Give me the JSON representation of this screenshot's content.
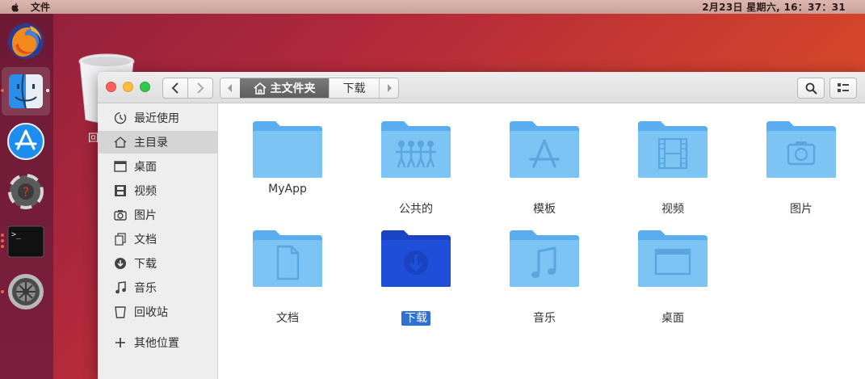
{
  "menubar": {
    "app_menu": "文件",
    "clock": "2月23日 星期六, 16：37：31"
  },
  "dock": {
    "items": [
      "firefox-icon",
      "finder-icon",
      "app-store-icon",
      "help-icon",
      "terminal-icon",
      "settings-icon"
    ]
  },
  "desktop": {
    "trash_label": "回"
  },
  "window": {
    "breadcrumb": {
      "home": "主文件夹",
      "current": "下载"
    }
  },
  "sidebar": {
    "items": [
      {
        "label": "最近使用",
        "icon": "recent-icon"
      },
      {
        "label": "主目录",
        "icon": "home-icon"
      },
      {
        "label": "桌面",
        "icon": "desktop-icon"
      },
      {
        "label": "视频",
        "icon": "video-icon"
      },
      {
        "label": "图片",
        "icon": "camera-icon"
      },
      {
        "label": "文档",
        "icon": "document-icon"
      },
      {
        "label": "下载",
        "icon": "download-icon"
      },
      {
        "label": "音乐",
        "icon": "music-icon"
      },
      {
        "label": "回收站",
        "icon": "trash-icon"
      },
      {
        "label": "其他位置",
        "icon": "plus-icon"
      }
    ],
    "selected": "主目录"
  },
  "files": [
    {
      "label": "MyApp",
      "icon": "folder-icon"
    },
    {
      "label": "公共的",
      "icon": "public-folder-icon"
    },
    {
      "label": "模板",
      "icon": "templates-folder-icon"
    },
    {
      "label": "视频",
      "icon": "videos-folder-icon"
    },
    {
      "label": "图片",
      "icon": "pictures-folder-icon"
    },
    {
      "label": "文档",
      "icon": "documents-folder-icon"
    },
    {
      "label": "下载",
      "icon": "downloads-folder-icon"
    },
    {
      "label": "音乐",
      "icon": "music-folder-icon"
    },
    {
      "label": "桌面",
      "icon": "desktop-folder-icon"
    }
  ],
  "selected_file": "下载",
  "colors": {
    "folder": "#7cc4f4",
    "folder_selected": "#1f4fd9",
    "selection": "#2f6fd8"
  }
}
